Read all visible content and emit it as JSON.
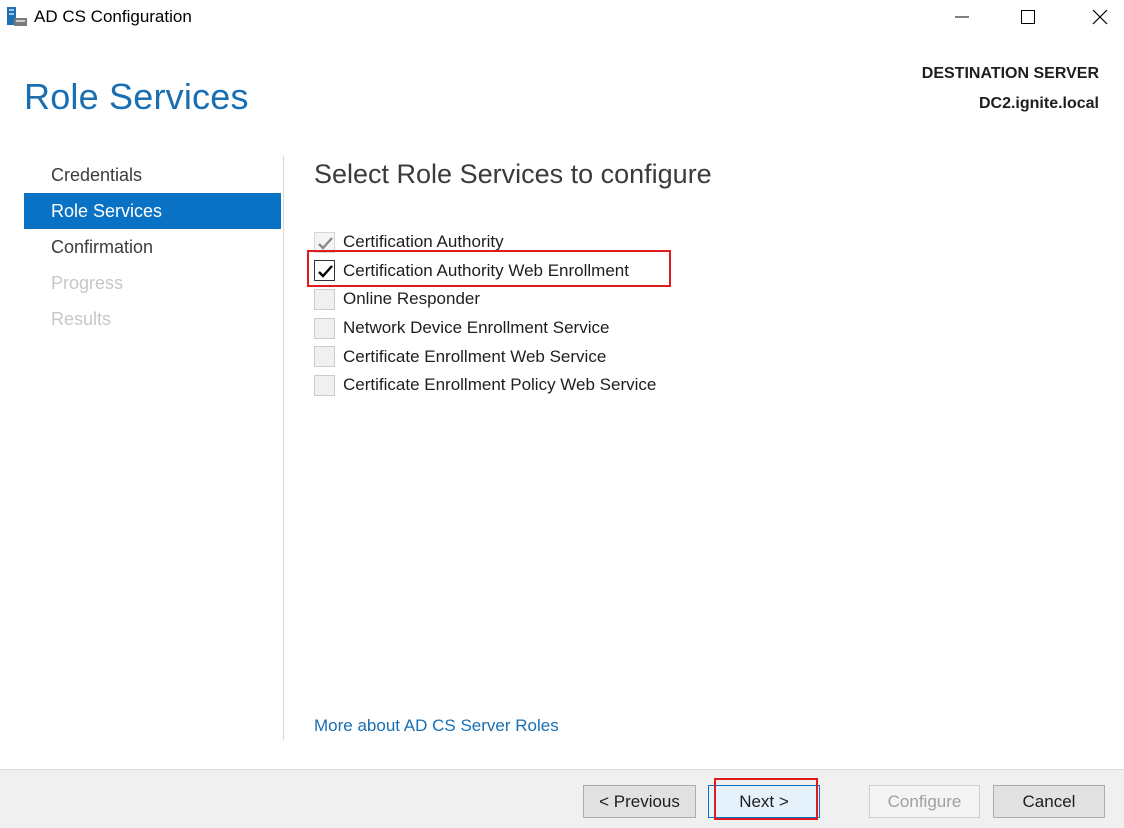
{
  "window": {
    "title": "AD CS Configuration",
    "icon": "adcs-server-icon"
  },
  "header": {
    "page_title": "Role Services",
    "destination_label": "DESTINATION SERVER",
    "destination_server": "DC2.ignite.local"
  },
  "nav": {
    "items": [
      {
        "label": "Credentials",
        "state": "normal"
      },
      {
        "label": "Role Services",
        "state": "selected"
      },
      {
        "label": "Confirmation",
        "state": "normal"
      },
      {
        "label": "Progress",
        "state": "disabled"
      },
      {
        "label": "Results",
        "state": "disabled"
      }
    ]
  },
  "main": {
    "section_title": "Select Role Services to configure",
    "role_services": [
      {
        "label": "Certification Authority",
        "checked": true,
        "enabled": false
      },
      {
        "label": "Certification Authority Web Enrollment",
        "checked": true,
        "enabled": true
      },
      {
        "label": "Online Responder",
        "checked": false,
        "enabled": false
      },
      {
        "label": "Network Device Enrollment Service",
        "checked": false,
        "enabled": false
      },
      {
        "label": "Certificate Enrollment Web Service",
        "checked": false,
        "enabled": false
      },
      {
        "label": "Certificate Enrollment Policy Web Service",
        "checked": false,
        "enabled": false
      }
    ],
    "more_link": "More about AD CS Server Roles"
  },
  "footer": {
    "previous_label": "< Previous",
    "next_label": "Next >",
    "configure_label": "Configure",
    "cancel_label": "Cancel"
  },
  "colors": {
    "accent": "#0a72c4",
    "title_blue": "#1a6fb3",
    "highlight_red": "#e01b1b"
  }
}
